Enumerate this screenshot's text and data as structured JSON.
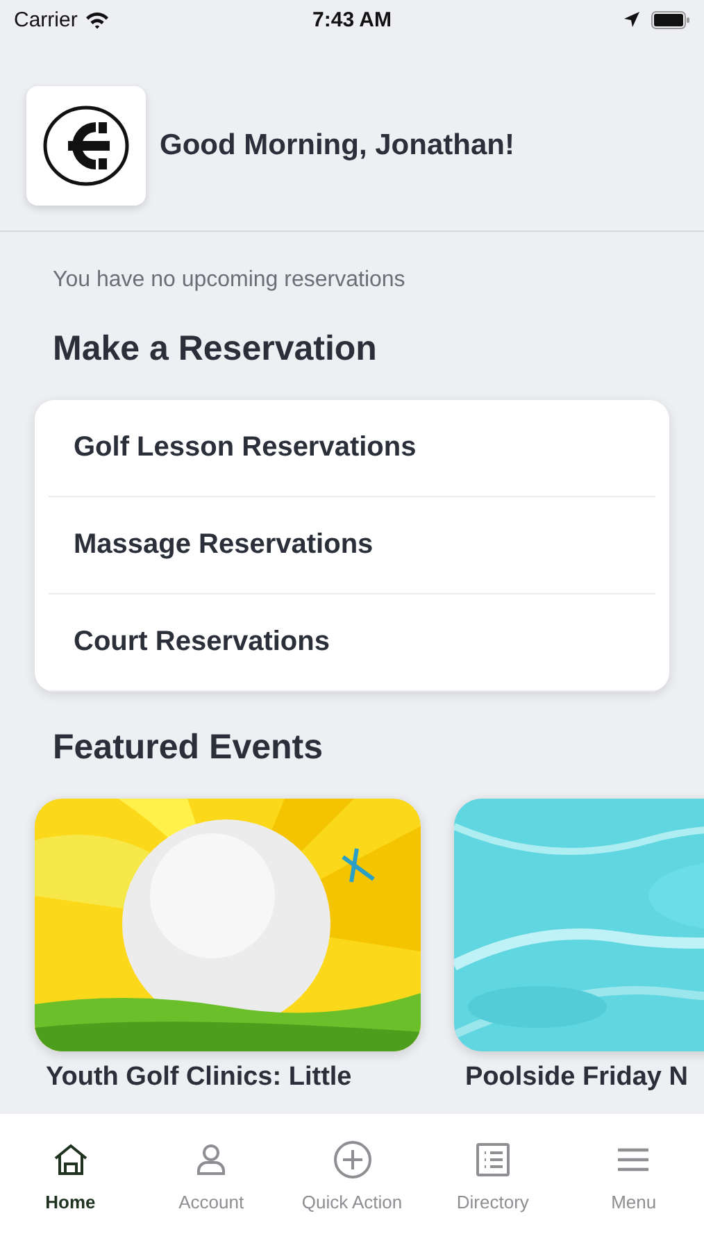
{
  "status_bar": {
    "carrier": "Carrier",
    "time": "7:43 AM"
  },
  "header": {
    "greeting": "Good Morning, Jonathan!"
  },
  "reservations_note": "You have no upcoming reservations",
  "make_reservation": {
    "title": "Make a Reservation",
    "items": [
      {
        "label": "Golf Lesson Reservations"
      },
      {
        "label": "Massage Reservations"
      },
      {
        "label": "Court Reservations"
      }
    ]
  },
  "featured_events": {
    "title": "Featured Events",
    "events": [
      {
        "title": "Youth Golf Clinics: Little",
        "kind": "golf"
      },
      {
        "title": "Poolside Friday N",
        "kind": "pool"
      }
    ]
  },
  "tab_bar": [
    {
      "label": "Home",
      "kind": "home",
      "selected": true
    },
    {
      "label": "Account",
      "kind": "person",
      "selected": false
    },
    {
      "label": "Quick Action",
      "kind": "plus",
      "selected": false
    },
    {
      "label": "Directory",
      "kind": "list",
      "selected": false
    },
    {
      "label": "Menu",
      "kind": "menu",
      "selected": false
    }
  ]
}
